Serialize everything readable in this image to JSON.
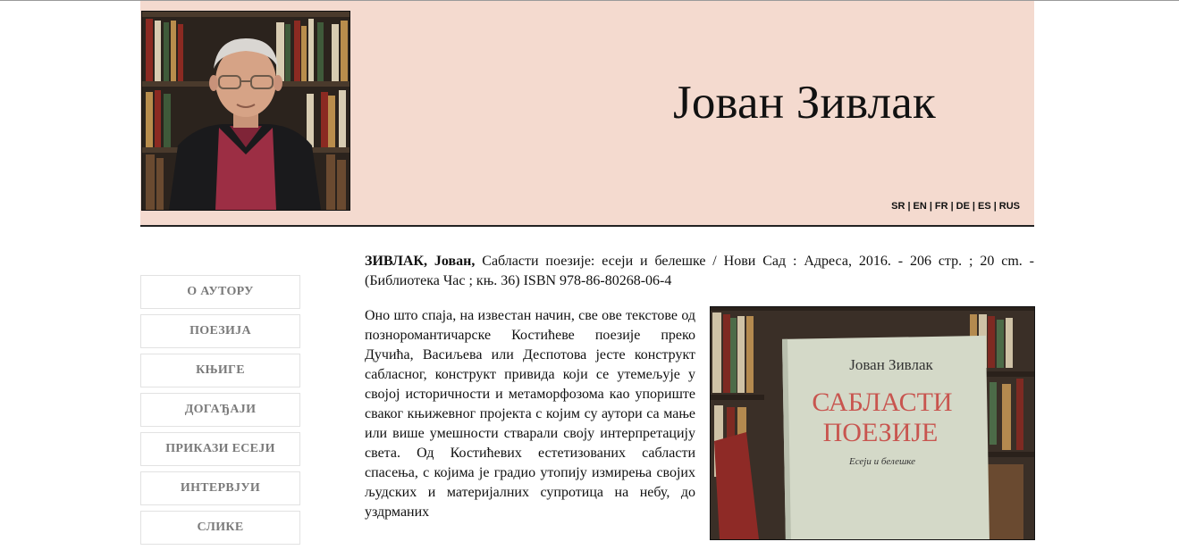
{
  "header": {
    "author_name": "Јован Зивлак",
    "languages": [
      "SR",
      "EN",
      "FR",
      "DE",
      "ES",
      "RUS"
    ]
  },
  "nav": {
    "items": [
      "О АУТОРУ",
      "ПОЕЗИЈА",
      "КЊИГЕ",
      "ДОГАЂАЈИ",
      "ПРИКАЗИ ЕСЕЈИ",
      "ИНТЕРВЈУИ",
      "СЛИКЕ"
    ]
  },
  "citation": {
    "author": "ЗИВЛАК, Јован,",
    "text": " Сабласти поезије: есеји и белешке / Нови Сад : Адреса, 2016. - 206 стр. ; 20 cm. - (Библиотека Час ; књ. 36) ISBN 978-86-80268-06-4"
  },
  "body_text": "Оно што спаја, на известан начин, све ове текстове од познoромантичарске Костићеве поезије преко Дучића, Васиљева или Деспотова јесте конструкт сабласног, конструкт привида који се утемељује у својој историчности и метаморфозома као упориште сваког књижевног пројекта с којим су аутори са мање или више умешности стварали своју интерпретацију света. Од Костићевих естетизованих сабласти спасења, с којима је градио утопију измирења својих људских и материјалних супротица на небу, до уздрманих",
  "book_cover": {
    "author": "Јован Зивлак",
    "title_line1": "САБЛАСТИ",
    "title_line2": "ПОЕЗИЈЕ",
    "subtitle": "Есеји и белешке",
    "title_color": "#c8554f"
  }
}
